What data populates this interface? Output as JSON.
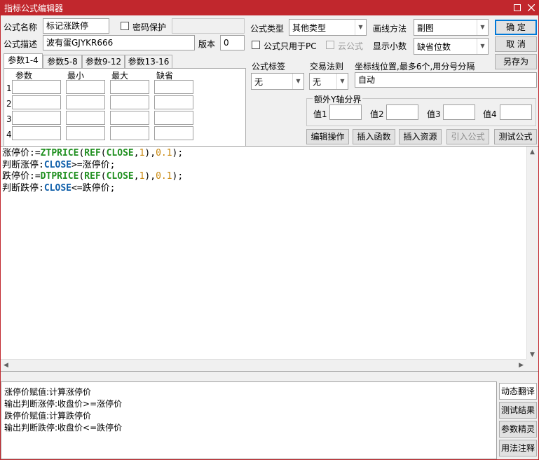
{
  "window": {
    "title": "指标公式编辑器"
  },
  "form": {
    "name_label": "公式名称",
    "name_value": "标记涨跌停",
    "password_label": "密码保护",
    "desc_label": "公式描述",
    "desc_value": "波有蛋GJYKR666",
    "version_label": "版本",
    "version_value": "0",
    "type_label": "公式类型",
    "type_value": "其他类型",
    "draw_label": "画线方法",
    "draw_value": "副图",
    "pc_only_label": "公式只用于PC",
    "cloud_label": "云公式",
    "decimals_label": "显示小数",
    "decimals_value": "缺省位数",
    "tag_label": "公式标签",
    "tag_value": "无",
    "trade_label": "交易法则",
    "trade_value": "无",
    "coord_label": "坐标线位置,最多6个,用分号分隔",
    "coord_value": "自动",
    "yaxis_label": "额外Y轴分界",
    "y_values": [
      "值1",
      "值2",
      "值3",
      "值4"
    ]
  },
  "buttons": {
    "ok": "确  定",
    "cancel": "取  消",
    "save_as": "另存为",
    "edit_ops": "编辑操作",
    "insert_func": "插入函数",
    "insert_res": "插入资源",
    "import_formula": "引入公式",
    "test_formula": "测试公式"
  },
  "param_tabs": [
    "参数1-4",
    "参数5-8",
    "参数9-12",
    "参数13-16"
  ],
  "param_headers": [
    "参数",
    "最小",
    "最大",
    "缺省"
  ],
  "param_rows": [
    "1",
    "2",
    "3",
    "4"
  ],
  "code_lines": [
    [
      {
        "t": "涨停价",
        "c": "c-ident"
      },
      {
        "t": ":=",
        "c": "c-op"
      },
      {
        "t": "ZTPRICE",
        "c": "c-fn"
      },
      {
        "t": "(",
        "c": "c-op"
      },
      {
        "t": "REF",
        "c": "c-fn"
      },
      {
        "t": "(",
        "c": "c-op"
      },
      {
        "t": "CLOSE",
        "c": "c-fn"
      },
      {
        "t": ",",
        "c": "c-op"
      },
      {
        "t": "1",
        "c": "c-num"
      },
      {
        "t": "),",
        "c": "c-op"
      },
      {
        "t": "0.1",
        "c": "c-num"
      },
      {
        "t": ");",
        "c": "c-op"
      }
    ],
    [
      {
        "t": "判断涨停",
        "c": "c-ident"
      },
      {
        "t": ":",
        "c": "c-op"
      },
      {
        "t": "CLOSE",
        "c": "c-kw"
      },
      {
        "t": ">=涨停价;",
        "c": "c-op"
      }
    ],
    [
      {
        "t": "跌停价",
        "c": "c-ident"
      },
      {
        "t": ":=",
        "c": "c-op"
      },
      {
        "t": "DTPRICE",
        "c": "c-fn"
      },
      {
        "t": "(",
        "c": "c-op"
      },
      {
        "t": "REF",
        "c": "c-fn"
      },
      {
        "t": "(",
        "c": "c-op"
      },
      {
        "t": "CLOSE",
        "c": "c-fn"
      },
      {
        "t": ",",
        "c": "c-op"
      },
      {
        "t": "1",
        "c": "c-num"
      },
      {
        "t": "),",
        "c": "c-op"
      },
      {
        "t": "0.1",
        "c": "c-num"
      },
      {
        "t": ");",
        "c": "c-op"
      }
    ],
    [
      {
        "t": "判断跌停",
        "c": "c-ident"
      },
      {
        "t": ":",
        "c": "c-op"
      },
      {
        "t": "CLOSE",
        "c": "c-kw"
      },
      {
        "t": "<=跌停价;",
        "c": "c-op"
      }
    ]
  ],
  "translation_lines": [
    "涨停价赋值:计算涨停价",
    "输出判断涨停:收盘价>=涨停价",
    "跌停价赋值:计算跌停价",
    "输出判断跌停:收盘价<=跌停价"
  ],
  "side_buttons": [
    "动态翻译",
    "测试结果",
    "参数精灵",
    "用法注释"
  ]
}
